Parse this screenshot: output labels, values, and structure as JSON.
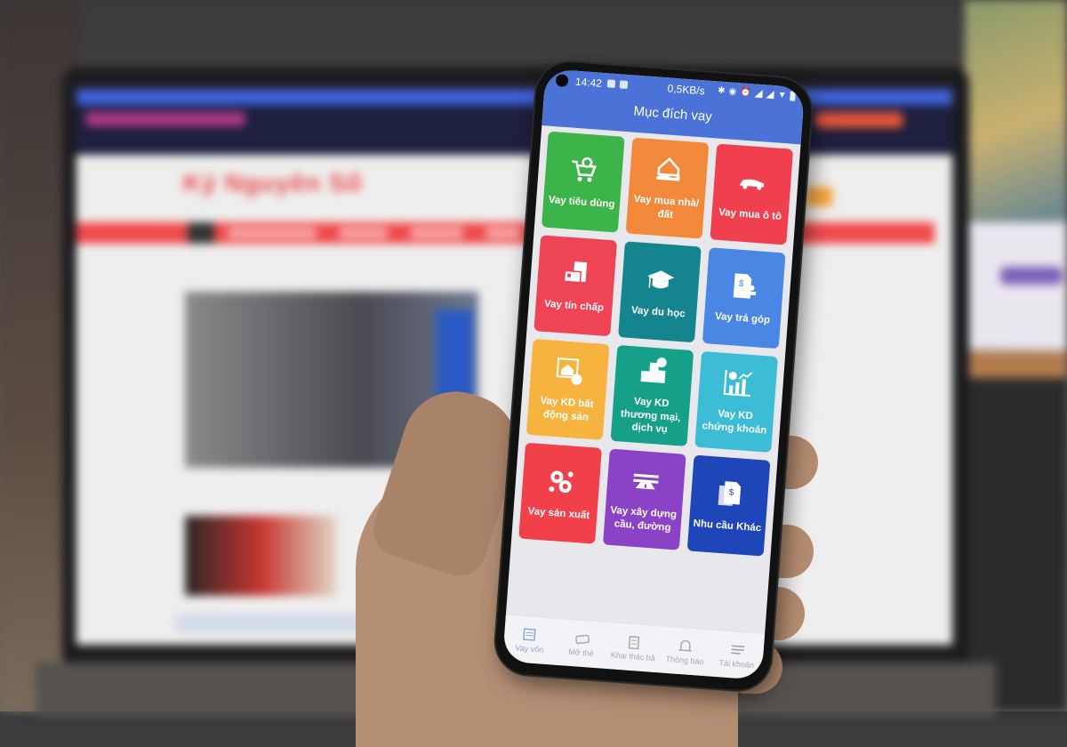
{
  "background": {
    "laptop_site_name": "Kỷ Nguyên Số"
  },
  "status_bar": {
    "time": "14:42",
    "network_speed": "0,5KB/s",
    "icons": [
      "message-icon",
      "notification-icon",
      "bluetooth-icon",
      "vibrate-icon",
      "alarm-icon",
      "signal-icon",
      "signal-icon",
      "wifi-icon",
      "battery-icon"
    ]
  },
  "app": {
    "title": "Mục đích vay",
    "header_color": "#4b72d6",
    "tiles": [
      {
        "label": "Vay tiêu dùng",
        "icon": "shopping-cart-coin-icon",
        "color": "#3cb44a"
      },
      {
        "label": "Vay mua nhà/ đất",
        "icon": "house-hand-icon",
        "color": "#f2893a"
      },
      {
        "label": "Vay mua ô tô",
        "icon": "car-icon",
        "color": "#f0404f"
      },
      {
        "label": "Vay tín chấp",
        "icon": "credit-card-document-icon",
        "color": "#ef4356"
      },
      {
        "label": "Vay du học",
        "icon": "graduation-cap-icon",
        "color": "#14858e"
      },
      {
        "label": "Vay trả góp",
        "icon": "invoice-stamp-icon",
        "color": "#4a86e4"
      },
      {
        "label": "Vay KD bất động sản",
        "icon": "property-money-icon",
        "color": "#f6b33f"
      },
      {
        "label": "Vay KD thương mại, dịch vụ",
        "icon": "buildings-coin-icon",
        "color": "#16a08a"
      },
      {
        "label": "Vay KD chứng khoán",
        "icon": "stock-chart-icon",
        "color": "#3dbcd6"
      },
      {
        "label": "Vay sản xuất",
        "icon": "gears-icon",
        "color": "#f2404a"
      },
      {
        "label": "Vay xây dựng cầu, đường",
        "icon": "road-bridge-icon",
        "color": "#8b43c6"
      },
      {
        "label": "Nhu cầu Khác",
        "icon": "documents-dollar-icon",
        "color": "#1f46b8"
      }
    ]
  },
  "bottom_nav": {
    "items": [
      {
        "label": "Vay vốn",
        "icon": "loan-icon",
        "active": true
      },
      {
        "label": "Mở thẻ",
        "icon": "card-icon",
        "active": false
      },
      {
        "label": "Khai thác bả",
        "icon": "building-icon",
        "active": false
      },
      {
        "label": "Thông báo",
        "icon": "bell-icon",
        "active": false
      },
      {
        "label": "Tài khoản",
        "icon": "menu-icon",
        "active": false
      }
    ]
  }
}
